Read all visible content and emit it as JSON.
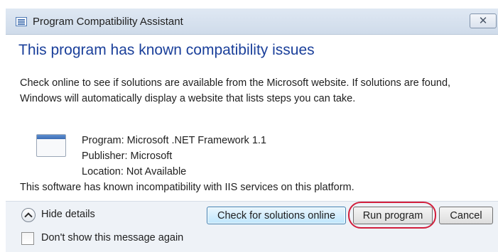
{
  "window": {
    "title": "Program Compatibility Assistant",
    "close_icon": "close-icon",
    "app_icon": "program-compatibility-icon"
  },
  "main": {
    "heading": "This program has known compatibility issues",
    "description": "Check online to see if solutions are available from the Microsoft website. If solutions are found, Windows will automatically display a website that lists steps you can take.",
    "program_icon": "application-window-icon",
    "details": {
      "program": "Program: Microsoft .NET Framework 1.1",
      "publisher": "Publisher: Microsoft",
      "location": "Location: Not Available"
    },
    "warning": "This software has known incompatibility with IIS services on this platform."
  },
  "footer": {
    "toggle_icon": "chevron-up-icon",
    "toggle_label": "Hide details",
    "checkbox_label": "Don't show this message again",
    "checkbox_checked": false
  },
  "buttons": {
    "check_online": "Check for solutions online",
    "run_program": "Run program",
    "cancel": "Cancel"
  },
  "colors": {
    "heading": "#1a3f9a",
    "highlight_ring": "#d21f3c",
    "default_button_border": "#3c7fb1"
  }
}
